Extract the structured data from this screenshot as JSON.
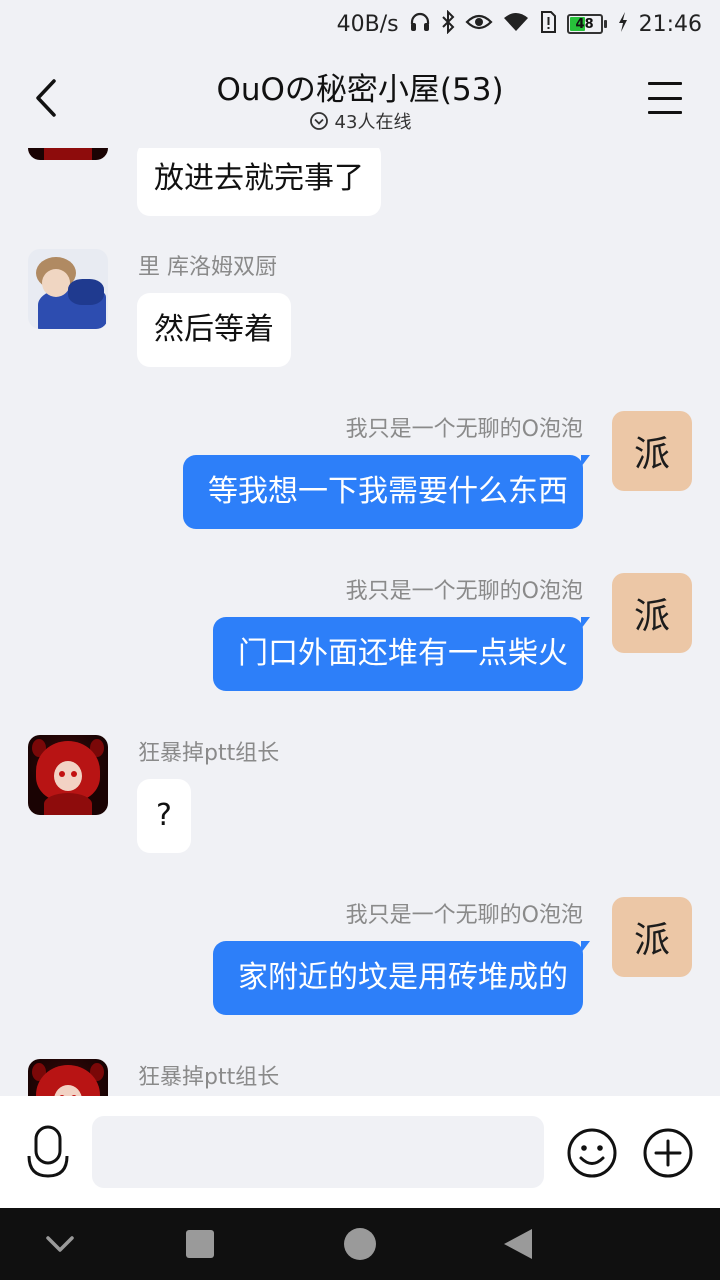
{
  "status_bar": {
    "net_speed": "40B/s",
    "battery": "48",
    "battery_level": 0.48,
    "time": "21:46"
  },
  "header": {
    "title": "OuOの秘密小屋(53)",
    "online": "43人在线"
  },
  "messages": [
    {
      "side": "left",
      "avatar": "red-hair-avatar",
      "sender": "",
      "text": "放进去就完事了"
    },
    {
      "side": "left",
      "avatar": "boy-avatar",
      "sender": "里 库洛姆双厨",
      "text": "然后等着"
    },
    {
      "side": "right",
      "avatar": "pai-avatar",
      "sender": "我只是一个无聊的O泡泡",
      "text": "等我想一下我需要什么东西"
    },
    {
      "side": "right",
      "avatar": "pai-avatar",
      "sender": "我只是一个无聊的O泡泡",
      "text": "门口外面还堆有一点柴火"
    },
    {
      "side": "left",
      "avatar": "red-hair-avatar",
      "sender": "狂暴掉ptt组长",
      "text": "?"
    },
    {
      "side": "right",
      "avatar": "pai-avatar",
      "sender": "我只是一个无聊的O泡泡",
      "text": "家附近的坟是用砖堆成的"
    },
    {
      "side": "left",
      "avatar": "red-hair-avatar",
      "sender": "狂暴掉ptt组长",
      "text": ""
    }
  ],
  "avatar_glyph": "派",
  "input": {
    "value": "",
    "placeholder": ""
  },
  "colors": {
    "accent": "#2d7ff9",
    "background": "#f0f1f5",
    "bubble_left": "#ffffff"
  },
  "icons": [
    "back-arrow-icon",
    "menu-icon",
    "headphone-icon",
    "bluetooth-icon",
    "eye-icon",
    "wifi-icon",
    "sim-alert-icon",
    "charging-icon",
    "chevron-down-circle-icon",
    "microphone-icon",
    "emoji-icon",
    "plus-icon",
    "nav-back-icon",
    "nav-recents-icon",
    "nav-home-icon",
    "nav-triangle-icon"
  ]
}
